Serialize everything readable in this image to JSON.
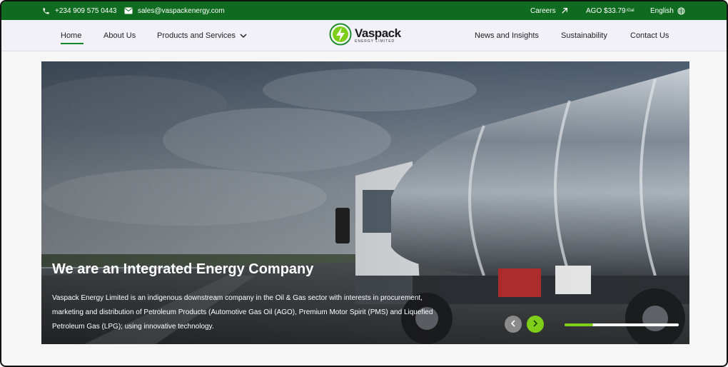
{
  "topbar": {
    "phone": "+234 909 575 0443",
    "email": "sales@vaspackenergy.com",
    "careers": "Careers",
    "ago_price": "AGO $33.79",
    "ago_unit": "/Gal",
    "language": "English",
    "background_color": "#0f6b1f"
  },
  "nav": {
    "home": "Home",
    "about": "About Us",
    "products": "Products and Services",
    "news": "News and Insights",
    "sustainability": "Sustainability",
    "contact": "Contact Us",
    "active_item": "Home"
  },
  "logo": {
    "brand": "Vaspack",
    "subtitle": "ENERGY LIMITED",
    "accent_color": "#7fcf1a"
  },
  "hero": {
    "title": "We are an Integrated Energy Company",
    "description": "Vaspack Energy Limited is an indigenous downstream company in the Oil & Gas sector with interests in procurement, marketing and distribution of Petroleum Products (Automotive Gas Oil (AGO), Premium Motor Spirit (PMS) and Liquefied Petroleum Gas (LPG); using innovative technology.",
    "slide_progress": 0.25
  },
  "colors": {
    "brand_green": "#0f6b1f",
    "accent_lime": "#7fcf1a",
    "underline_green": "#16862a"
  }
}
